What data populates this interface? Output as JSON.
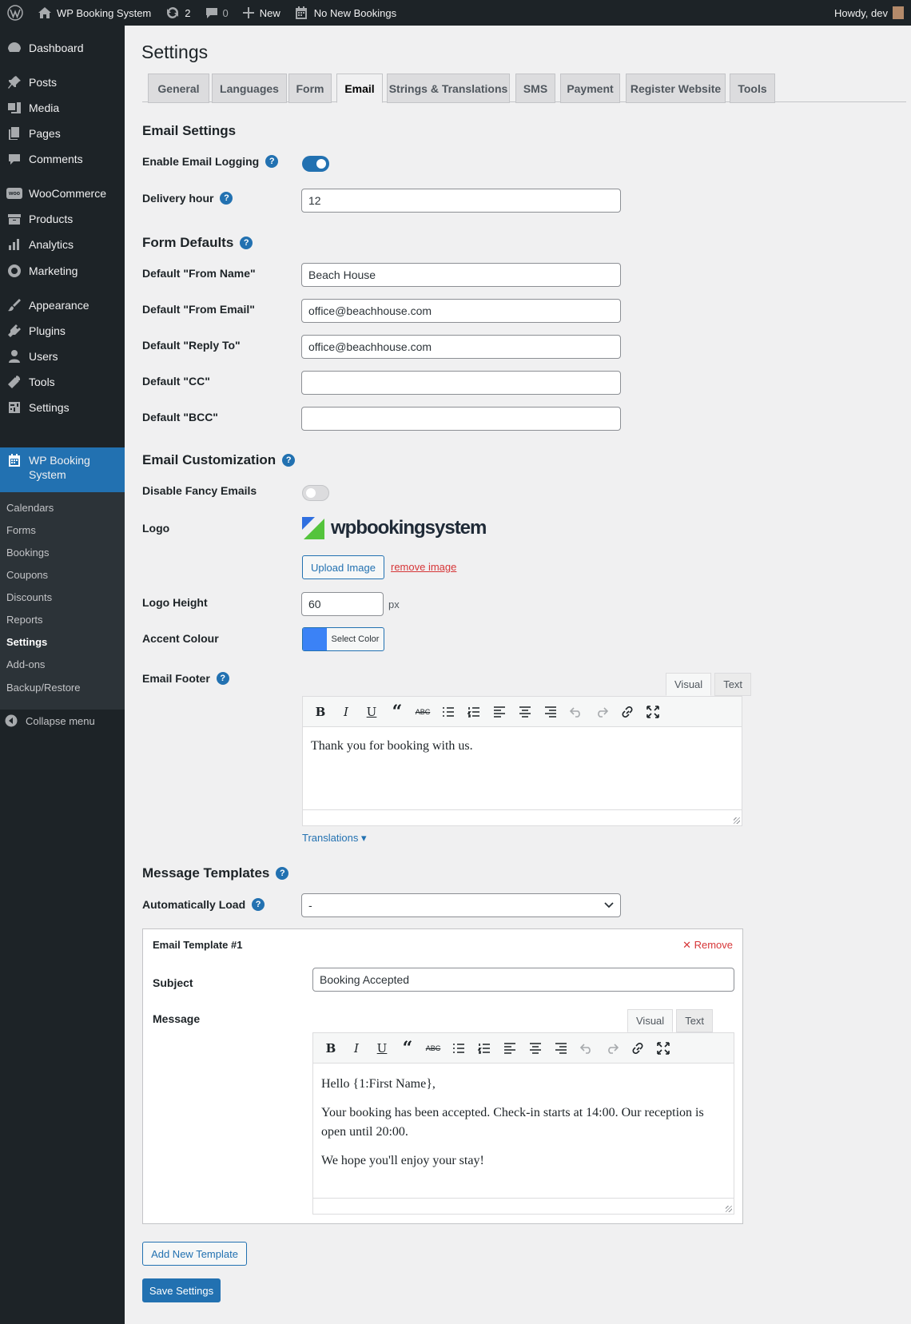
{
  "adminbar": {
    "site_name": "WP Booking System",
    "updates": "2",
    "comments": "0",
    "new_label": "New",
    "bookings": "No New Bookings",
    "howdy": "Howdy, dev"
  },
  "sidebar": {
    "items": [
      {
        "label": "Dashboard",
        "icon": "dashboard-icon"
      },
      {
        "label": "Posts",
        "icon": "pin-icon"
      },
      {
        "label": "Media",
        "icon": "media-icon"
      },
      {
        "label": "Pages",
        "icon": "pages-icon"
      },
      {
        "label": "Comments",
        "icon": "comment-icon"
      },
      {
        "label": "WooCommerce",
        "icon": "woo-icon"
      },
      {
        "label": "Products",
        "icon": "archive-icon"
      },
      {
        "label": "Analytics",
        "icon": "bar-chart-icon"
      },
      {
        "label": "Marketing",
        "icon": "megaphone-icon"
      },
      {
        "label": "Appearance",
        "icon": "brush-icon"
      },
      {
        "label": "Plugins",
        "icon": "plugin-icon"
      },
      {
        "label": "Users",
        "icon": "user-icon"
      },
      {
        "label": "Tools",
        "icon": "wrench-icon"
      },
      {
        "label": "Settings",
        "icon": "settings-icon"
      },
      {
        "label": "WP Booking System",
        "icon": "calendar-icon"
      }
    ],
    "submenu": [
      "Calendars",
      "Forms",
      "Bookings",
      "Coupons",
      "Discounts",
      "Reports",
      "Settings",
      "Add-ons",
      "Backup/Restore"
    ],
    "collapse": "Collapse menu"
  },
  "page": {
    "title": "Settings",
    "tabs": [
      "General",
      "Languages",
      "Form",
      "Email",
      "Strings & Translations",
      "SMS",
      "Payment",
      "Register Website",
      "Tools"
    ],
    "active_tab": "Email"
  },
  "email_settings": {
    "heading": "Email Settings",
    "logging_label": "Enable Email Logging",
    "logging_enabled": true,
    "delivery_label": "Delivery hour",
    "delivery_value": "12"
  },
  "form_defaults": {
    "heading": "Form Defaults",
    "from_name_label": "Default \"From Name\"",
    "from_name_value": "Beach House",
    "from_email_label": "Default \"From Email\"",
    "from_email_value": "office@beachhouse.com",
    "reply_to_label": "Default \"Reply To\"",
    "reply_to_value": "office@beachhouse.com",
    "cc_label": "Default \"CC\"",
    "cc_value": "",
    "bcc_label": "Default \"BCC\"",
    "bcc_value": ""
  },
  "customization": {
    "heading": "Email Customization",
    "fancy_label": "Disable Fancy Emails",
    "fancy_disabled": false,
    "logo_label": "Logo",
    "logo_text": "wpbookingsystem",
    "upload_button": "Upload Image",
    "remove_image": "remove image",
    "logo_height_label": "Logo Height",
    "logo_height_value": "60",
    "logo_height_unit": "px",
    "accent_label": "Accent Colour",
    "accent_color": "#3b82f6",
    "select_color": "Select Color",
    "footer_label": "Email Footer",
    "footer_text": "Thank you for booking with us.",
    "translations_link": "Translations ▾"
  },
  "editor": {
    "visual_tab": "Visual",
    "text_tab": "Text"
  },
  "templates": {
    "heading": "Message Templates",
    "auto_load_label": "Automatically Load",
    "auto_load_value": "-",
    "template_title": "Email Template #1",
    "remove": "✕ Remove",
    "subject_label": "Subject",
    "subject_value": "Booking Accepted",
    "message_label": "Message",
    "message_p1": "Hello {1:First Name},",
    "message_p2": "Your booking has been accepted. Check-in starts at 14:00. Our reception is open until 20:00.",
    "message_p3": "We hope you'll enjoy your stay!",
    "add_new": "Add New Template",
    "save": "Save Settings"
  }
}
